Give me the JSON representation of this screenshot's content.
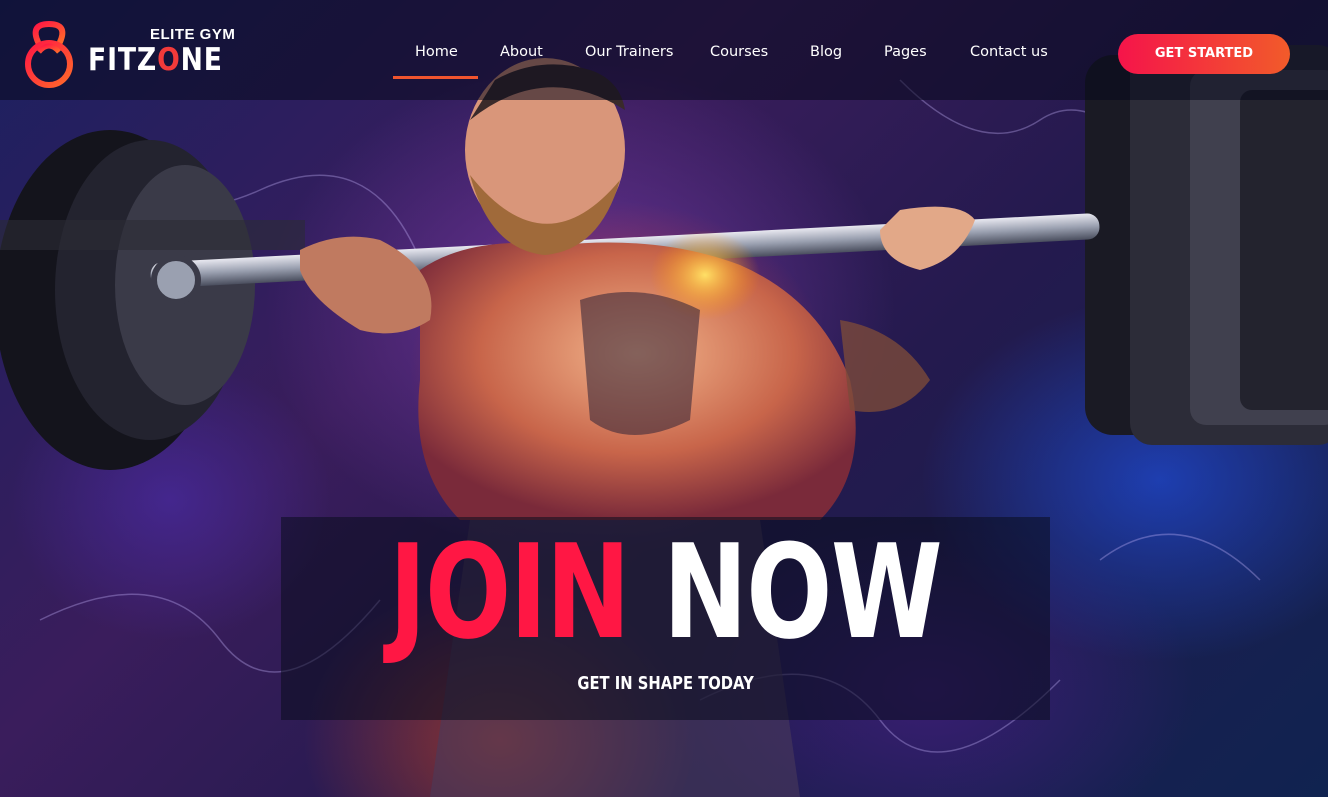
{
  "brand": {
    "tagline": "ELITE GYM",
    "name_prefix": "FITZ",
    "name_accent": "O",
    "name_suffix": "NE",
    "logo_icon": "kettlebell-logo-icon",
    "accent_color": "#f23a3a"
  },
  "nav": {
    "items": [
      {
        "label": "Home",
        "active": true
      },
      {
        "label": "About"
      },
      {
        "label": "Our Trainers"
      },
      {
        "label": "Courses"
      },
      {
        "label": "Blog"
      },
      {
        "label": "Pages"
      },
      {
        "label": "Contact us"
      }
    ],
    "cta_label": "GET STARTED",
    "cta_gradient": [
      "#f5144a",
      "#f25b2a"
    ]
  },
  "hero": {
    "headline_word_1": "JOIN",
    "headline_word_2": "NOW",
    "headline_color_1": "#ff1744",
    "headline_color_2": "#ffffff",
    "subheadline": "GET IN SHAPE TODAY",
    "image": "bodybuilder-barbell-squat"
  }
}
